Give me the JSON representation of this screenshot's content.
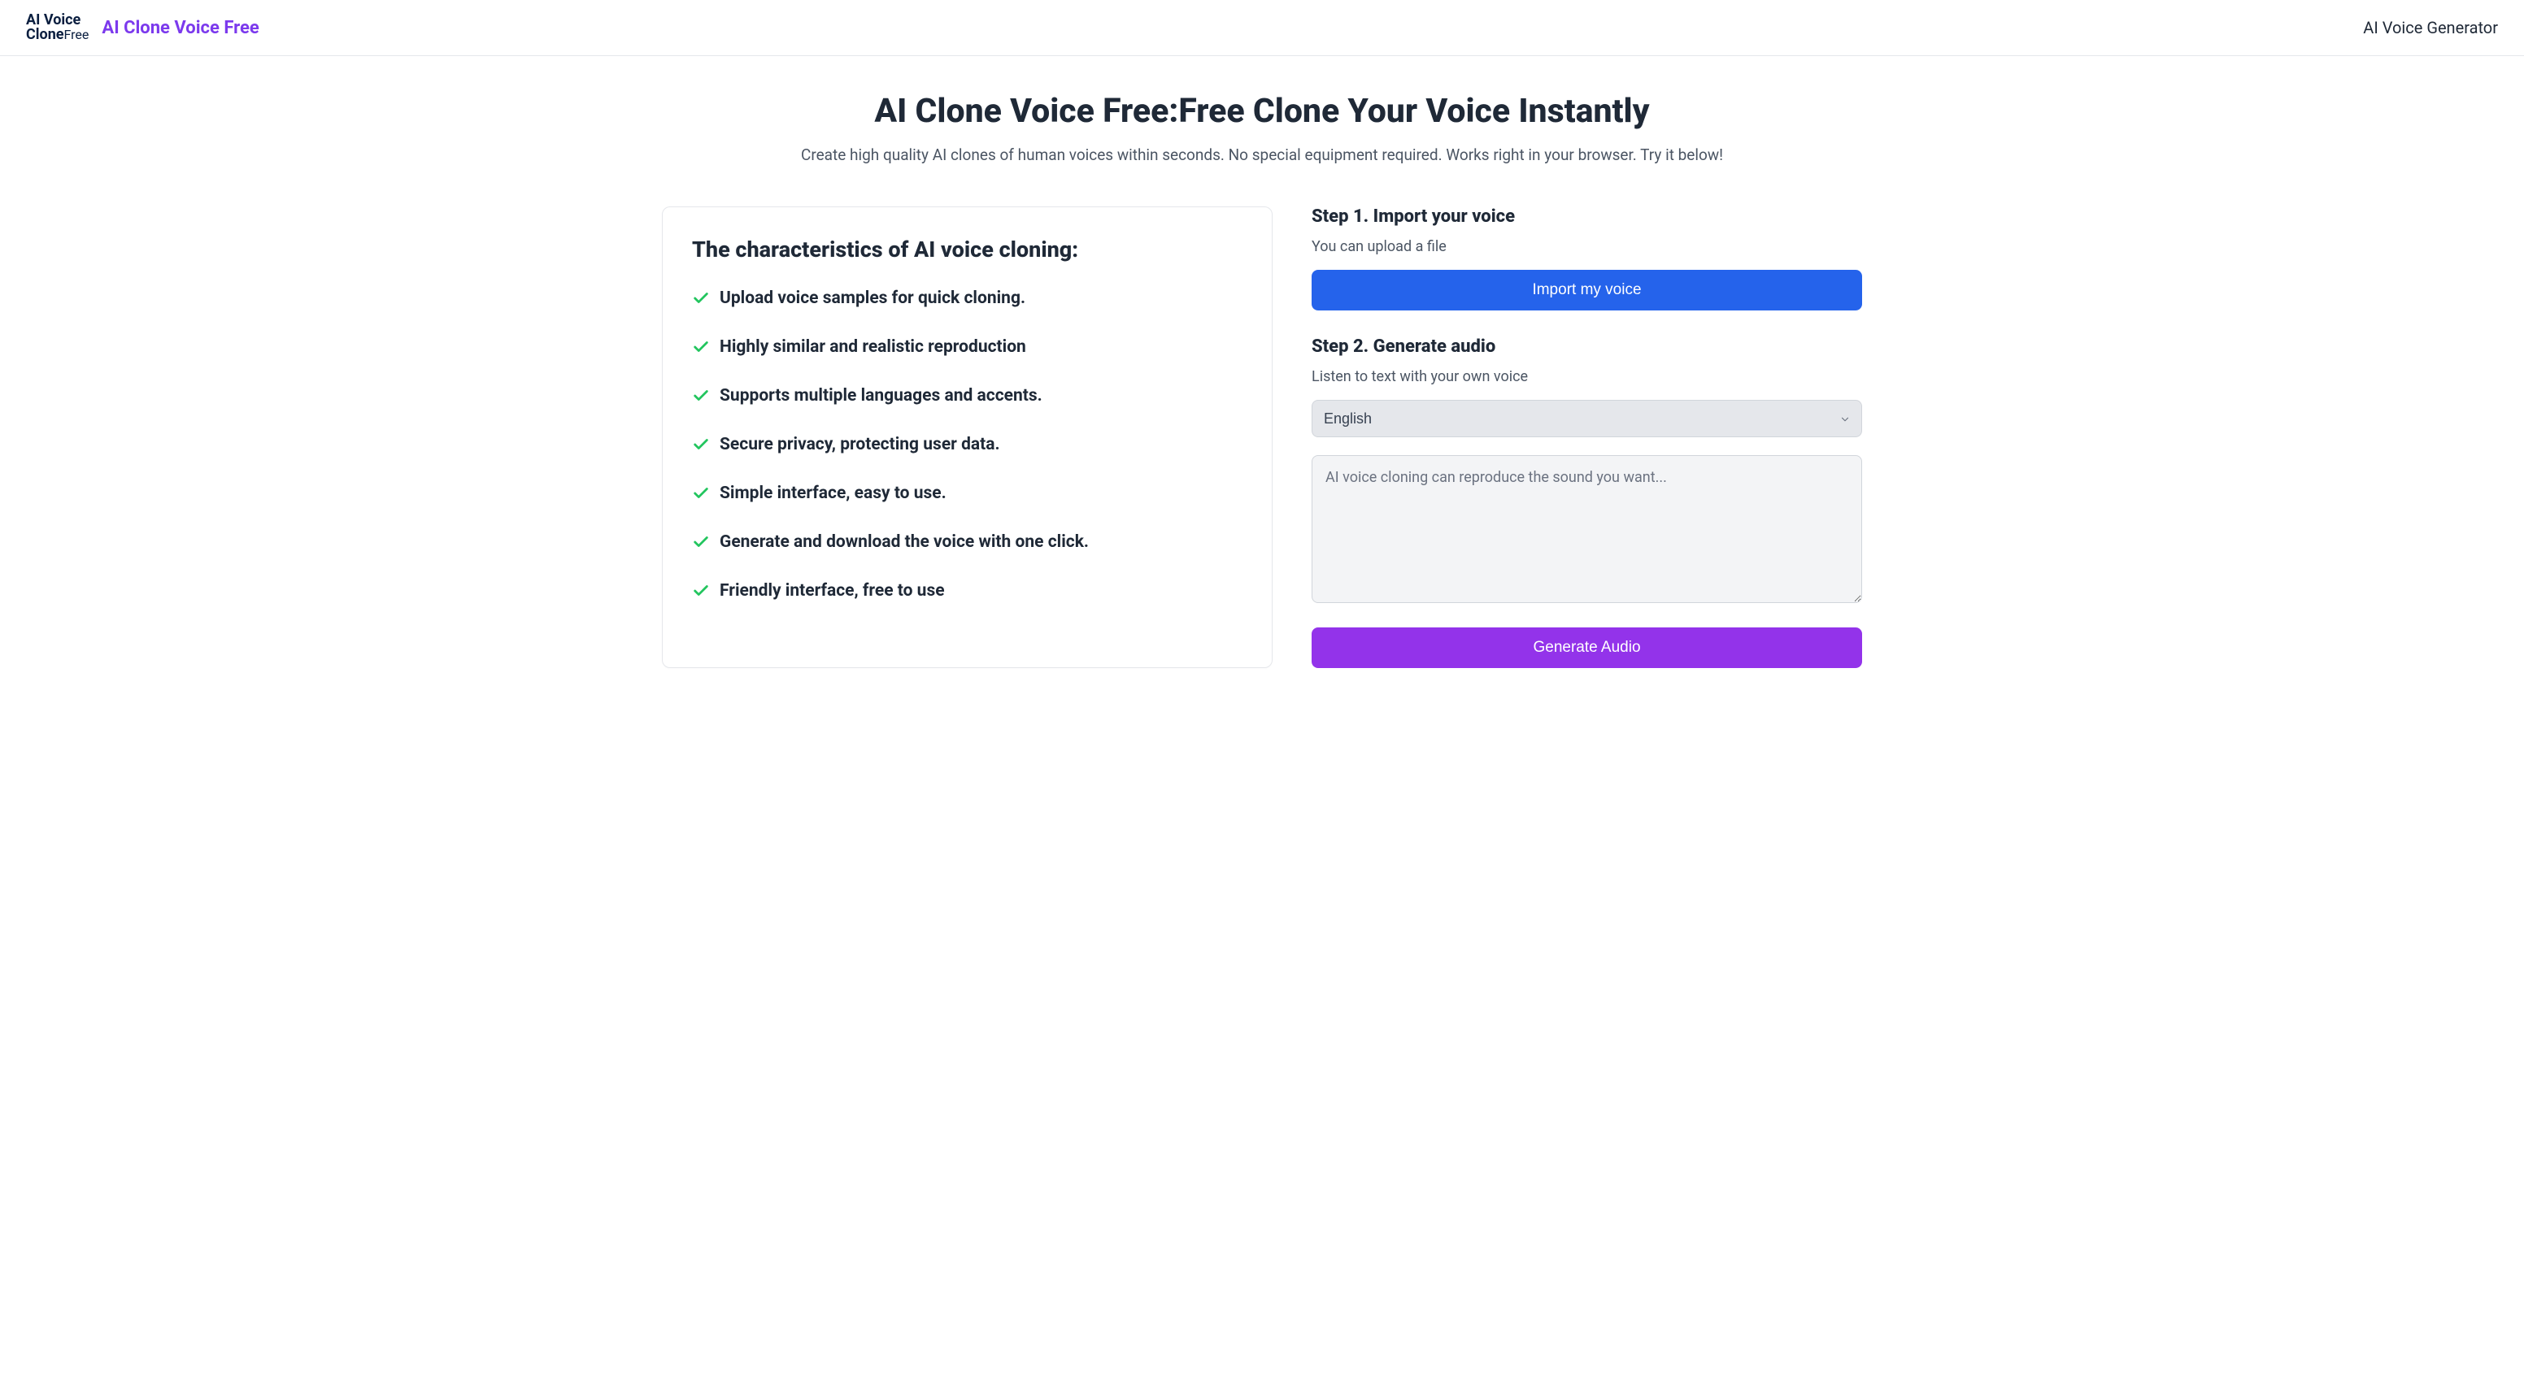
{
  "header": {
    "logo_line1": "AI Voice",
    "logo_line2_clone": "Clone",
    "logo_line2_free": "Free",
    "brand": "AI Clone Voice Free",
    "nav_link": "AI Voice Generator"
  },
  "hero": {
    "title": "AI Clone Voice Free:Free Clone Your Voice Instantly",
    "subtitle": "Create high quality AI clones of human voices within seconds. No special equipment required. Works right in your browser. Try it below!"
  },
  "card": {
    "title": "The characteristics of AI voice cloning:",
    "features": [
      "Upload voice samples for quick cloning.",
      "Highly similar and realistic reproduction",
      "Supports multiple languages and accents.",
      "Secure privacy, protecting user data.",
      "Simple interface, easy to use.",
      "Generate and download the voice with one click.",
      "Friendly interface, free to use"
    ]
  },
  "step1": {
    "title": "Step 1. Import your voice",
    "subtitle": "You can upload a file",
    "button": "Import my voice"
  },
  "step2": {
    "title": "Step 2. Generate audio",
    "subtitle": "Listen to text with your own voice",
    "language": "English",
    "textarea_placeholder": "AI voice cloning can reproduce the sound you want...",
    "button": "Generate Audio"
  }
}
